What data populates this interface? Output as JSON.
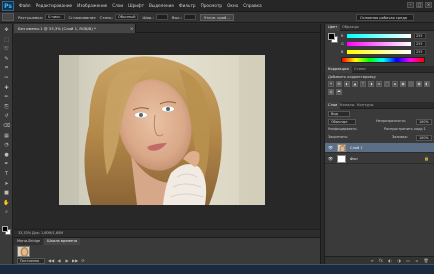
{
  "app": {
    "logo": "Ps",
    "menu": [
      "Файл",
      "Редактирование",
      "Изображение",
      "Слои",
      "Шрифт",
      "Выделение",
      "Фильтр",
      "Просмотр",
      "Окно",
      "Справка"
    ],
    "window_buttons": [
      "–",
      "□",
      "×"
    ]
  },
  "options_bar": {
    "feather_label": "Растушевка:",
    "feather_value": "0 пикс.",
    "antialias_label": "Сглаживание",
    "style_label": "Стиль:",
    "style_value": "Обычный",
    "width_label": "Шир.:",
    "height_label": "Выс.:",
    "refine_button": "Уточн. край...",
    "workspace": "Основная рабочая среда"
  },
  "tools": {
    "icons": [
      "move-icon",
      "marquee-icon",
      "lasso-icon",
      "quick-select-icon",
      "crop-icon",
      "eyedropper-icon",
      "healing-icon",
      "brush-icon",
      "clone-stamp-icon",
      "history-brush-icon",
      "eraser-icon",
      "gradient-icon",
      "blur-icon",
      "dodge-icon",
      "pen-icon",
      "type-icon",
      "path-select-icon",
      "shape-icon",
      "hand-icon",
      "zoom-icon"
    ],
    "foreground_color": "#000000",
    "background_color": "#ffffff"
  },
  "document": {
    "tab_title": "Без имени-1 @ 33,3% (Слой 1, RGB/8) *",
    "close": "×",
    "status": "33,33%    Док: 1,60M/1,60M"
  },
  "bottom_panel": {
    "tabs": [
      "Мини-Bridge",
      "Шкала времени"
    ],
    "frame_label": "0 сек.",
    "loop_select": "Постоянно",
    "controls": [
      "◀◀",
      "◀",
      "▶",
      "▶▶",
      "⟳"
    ]
  },
  "color_panel": {
    "tabs": [
      "Цвет",
      "Образцы"
    ],
    "rows": [
      {
        "label": "R",
        "value": "255",
        "gradient": "linear-gradient(90deg,#00ffff,#ffffff)"
      },
      {
        "label": "G",
        "value": "255",
        "gradient": "linear-gradient(90deg,#ff00ff,#ffffff)"
      },
      {
        "label": "B",
        "value": "255",
        "gradient": "linear-gradient(90deg,#ffff00,#ffffff)"
      }
    ]
  },
  "adjustments_panel": {
    "tabs": [
      "Коррекция",
      "Стили"
    ],
    "title": "Добавить корректировку",
    "icons": [
      "☀",
      "▤",
      "◐",
      "▲",
      "▽",
      "◑",
      "⚖",
      "□",
      "◈",
      "▣",
      "◫",
      "▦",
      "◧",
      "▥",
      "⬒"
    ]
  },
  "layers_panel": {
    "tabs": [
      "Слои",
      "Каналы",
      "Контуры"
    ],
    "kind_label": "Вид",
    "blend_mode": "Обычные",
    "opacity_label": "Непрозрачность:",
    "opacity_value": "100%",
    "lock_label": "Унифицировать:",
    "propagate_label": "Распространить кадр 1",
    "lock2_label": "Закрепить:",
    "fill_label": "Заливка:",
    "fill_value": "100%",
    "layers": [
      {
        "name": "Слой 1",
        "active": true,
        "eye": "👁",
        "lock": ""
      },
      {
        "name": "Фон",
        "active": false,
        "eye": "👁",
        "lock": "🔒"
      }
    ],
    "footer_icons": [
      "∞",
      "fx",
      "◐",
      "◑",
      "▭",
      "▫",
      "🗑"
    ]
  }
}
